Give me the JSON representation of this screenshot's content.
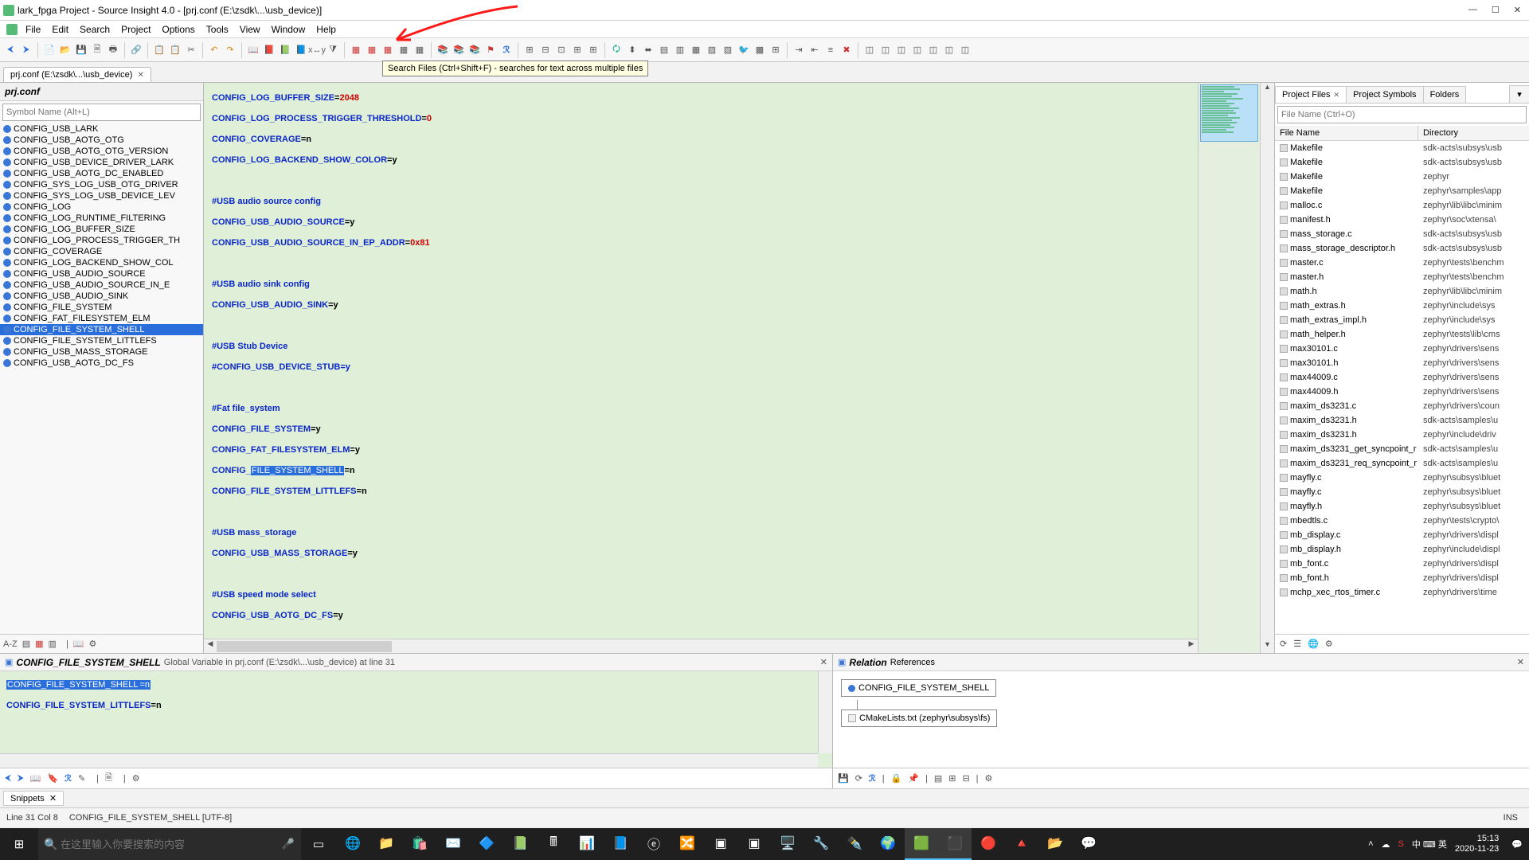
{
  "title": "lark_fpga Project - Source Insight 4.0 - [prj.conf (E:\\zsdk\\...\\usb_device)]",
  "menus": [
    "File",
    "Edit",
    "Search",
    "Project",
    "Options",
    "Tools",
    "View",
    "Window",
    "Help"
  ],
  "tooltip": "Search Files (Ctrl+Shift+F) - searches for text across multiple files",
  "file_tab": "prj.conf (E:\\zsdk\\...\\usb_device)",
  "left": {
    "header": "prj.conf",
    "placeholder": "Symbol Name (Alt+L)",
    "selected_index": 18,
    "symbols": [
      "CONFIG_USB_LARK",
      "CONFIG_USB_AOTG_OTG",
      "CONFIG_USB_AOTG_OTG_VERSION",
      "CONFIG_USB_DEVICE_DRIVER_LARK",
      "CONFIG_USB_AOTG_DC_ENABLED",
      "CONFIG_SYS_LOG_USB_OTG_DRIVER",
      "CONFIG_SYS_LOG_USB_DEVICE_LEV",
      "CONFIG_LOG",
      "CONFIG_LOG_RUNTIME_FILTERING",
      "CONFIG_LOG_BUFFER_SIZE",
      "CONFIG_LOG_PROCESS_TRIGGER_TH",
      "CONFIG_COVERAGE",
      "CONFIG_LOG_BACKEND_SHOW_COL",
      "CONFIG_USB_AUDIO_SOURCE",
      "CONFIG_USB_AUDIO_SOURCE_IN_E",
      "CONFIG_USB_AUDIO_SINK",
      "CONFIG_FILE_SYSTEM",
      "CONFIG_FAT_FILESYSTEM_ELM",
      "CONFIG_FILE_SYSTEM_SHELL",
      "CONFIG_FILE_SYSTEM_LITTLEFS",
      "CONFIG_USB_MASS_STORAGE",
      "CONFIG_USB_AOTG_DC_FS"
    ]
  },
  "editor": {
    "l1": {
      "k": "CONFIG_LOG_BUFFER_SIZE",
      "v": "2048",
      "num": true
    },
    "l2": {
      "k": "CONFIG_LOG_PROCESS_TRIGGER_THRESHOLD",
      "v": "0",
      "num": true
    },
    "l3": {
      "k": "CONFIG_COVERAGE",
      "v": "n"
    },
    "l4": {
      "k": "CONFIG_LOG_BACKEND_SHOW_COLOR",
      "v": "y"
    },
    "c1": "#USB audio source config",
    "l5": {
      "k": "CONFIG_USB_AUDIO_SOURCE",
      "v": "y"
    },
    "l6": {
      "k": "CONFIG_USB_AUDIO_SOURCE_IN_EP_ADDR",
      "v": "0x81",
      "num": true
    },
    "c2": "#USB audio sink config",
    "l7": {
      "k": "CONFIG_USB_AUDIO_SINK",
      "v": "y"
    },
    "c3": "#USB Stub Device",
    "c4": "#CONFIG_USB_DEVICE_STUB=y",
    "c5": "#Fat file_system",
    "l8": {
      "k": "CONFIG_FILE_SYSTEM",
      "v": "y"
    },
    "l9": {
      "k": "CONFIG_FAT_FILESYSTEM_ELM",
      "v": "y"
    },
    "l10": {
      "pre": "CONFIG_",
      "hl": "FILE_SYSTEM_SHELL",
      "v": "n"
    },
    "l11": {
      "k": "CONFIG_FILE_SYSTEM_LITTLEFS",
      "v": "n"
    },
    "c6": "#USB mass_storage",
    "l12": {
      "k": "CONFIG_USB_MASS_STORAGE",
      "v": "y"
    },
    "c7": "#USB speed mode select",
    "l13": {
      "k": "CONFIG_USB_AOTG_DC_FS",
      "v": "y"
    }
  },
  "right": {
    "tabs": [
      "Project Files",
      "Project Symbols",
      "Folders"
    ],
    "placeholder": "File Name (Ctrl+O)",
    "cols": [
      "File Name",
      "Directory"
    ],
    "rows": [
      [
        "Makefile",
        "sdk-acts\\subsys\\usb"
      ],
      [
        "Makefile",
        "sdk-acts\\subsys\\usb"
      ],
      [
        "Makefile",
        "zephyr"
      ],
      [
        "Makefile",
        "zephyr\\samples\\app"
      ],
      [
        "malloc.c",
        "zephyr\\lib\\libc\\minim"
      ],
      [
        "manifest.h",
        "zephyr\\soc\\xtensa\\"
      ],
      [
        "mass_storage.c",
        "sdk-acts\\subsys\\usb"
      ],
      [
        "mass_storage_descriptor.h",
        "sdk-acts\\subsys\\usb"
      ],
      [
        "master.c",
        "zephyr\\tests\\benchm"
      ],
      [
        "master.h",
        "zephyr\\tests\\benchm"
      ],
      [
        "math.h",
        "zephyr\\lib\\libc\\minim"
      ],
      [
        "math_extras.h",
        "zephyr\\include\\sys"
      ],
      [
        "math_extras_impl.h",
        "zephyr\\include\\sys"
      ],
      [
        "math_helper.h",
        "zephyr\\tests\\lib\\cms"
      ],
      [
        "max30101.c",
        "zephyr\\drivers\\sens"
      ],
      [
        "max30101.h",
        "zephyr\\drivers\\sens"
      ],
      [
        "max44009.c",
        "zephyr\\drivers\\sens"
      ],
      [
        "max44009.h",
        "zephyr\\drivers\\sens"
      ],
      [
        "maxim_ds3231.c",
        "zephyr\\drivers\\coun"
      ],
      [
        "maxim_ds3231.h",
        "sdk-acts\\samples\\u"
      ],
      [
        "maxim_ds3231.h",
        "zephyr\\include\\driv"
      ],
      [
        "maxim_ds3231_get_syncpoint_r",
        "sdk-acts\\samples\\u"
      ],
      [
        "maxim_ds3231_req_syncpoint_r",
        "sdk-acts\\samples\\u"
      ],
      [
        "mayfly.c",
        "zephyr\\subsys\\bluet"
      ],
      [
        "mayfly.c",
        "zephyr\\subsys\\bluet"
      ],
      [
        "mayfly.h",
        "zephyr\\subsys\\bluet"
      ],
      [
        "mbedtls.c",
        "zephyr\\tests\\crypto\\"
      ],
      [
        "mb_display.c",
        "zephyr\\drivers\\displ"
      ],
      [
        "mb_display.h",
        "zephyr\\include\\displ"
      ],
      [
        "mb_font.c",
        "zephyr\\drivers\\displ"
      ],
      [
        "mb_font.h",
        "zephyr\\drivers\\displ"
      ],
      [
        "mchp_xec_rtos_timer.c",
        "zephyr\\drivers\\time"
      ]
    ]
  },
  "ctx": {
    "title": "CONFIG_FILE_SYSTEM_SHELL",
    "sub": "Global Variable in prj.conf (E:\\zsdk\\...\\usb_device) at line 31",
    "l1": {
      "k": "CONFIG_FILE_SYSTEM_SHELL",
      "v": "=n"
    },
    "l2": {
      "k": "CONFIG_FILE_SYSTEM_LITTLEFS",
      "v": "=n"
    }
  },
  "rel": {
    "title": "Relation",
    "sub": "References",
    "n1": "CONFIG_FILE_SYSTEM_SHELL",
    "n2": "CMakeLists.txt (zephyr\\subsys\\fs)"
  },
  "snip": "Snippets",
  "status": {
    "pos": "Line 31   Col 8",
    "sym": "CONFIG_FILE_SYSTEM_SHELL [UTF-8]",
    "ins": "INS"
  },
  "taskbar": {
    "search_placeholder": "在这里输入你要搜索的内容",
    "ime": "中 ⌨ 英",
    "time": "15:13",
    "date": "2020-11-23"
  }
}
